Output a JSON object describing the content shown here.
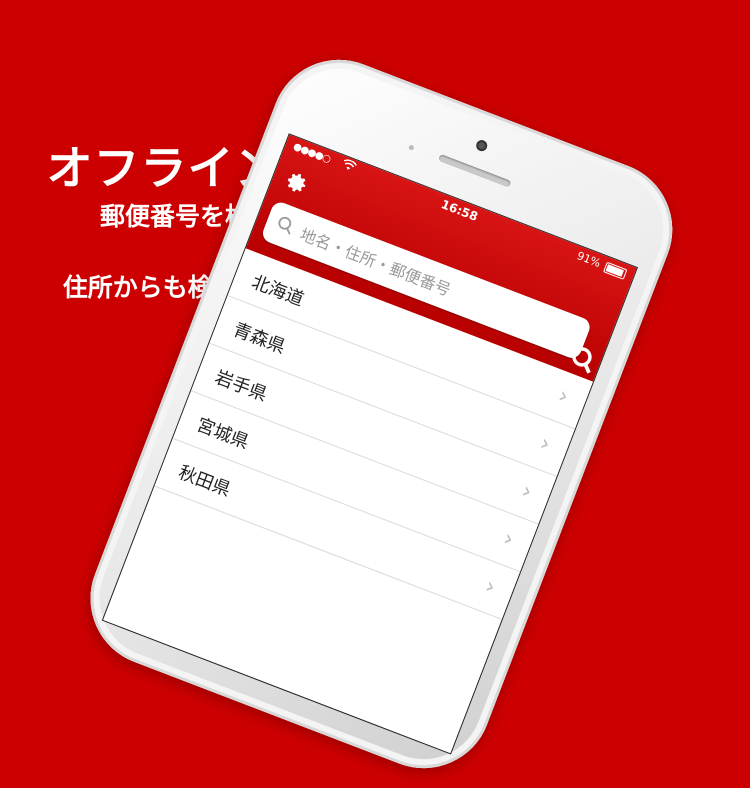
{
  "promo": {
    "line1": "オフラインで",
    "line2": "郵便番号を検索",
    "line3": "住所からも検索できる"
  },
  "status_bar": {
    "signal": "●●●●○",
    "wifi": "wifi-icon",
    "time": "16:58",
    "battery_text": "91%"
  },
  "nav": {
    "settings_icon": "gear-icon",
    "search_icon": "search-icon"
  },
  "search": {
    "placeholder": "地名・住所・郵便番号"
  },
  "prefectures": [
    {
      "label": "北海道"
    },
    {
      "label": "青森県"
    },
    {
      "label": "岩手県"
    },
    {
      "label": "宮城県"
    },
    {
      "label": "秋田県"
    }
  ],
  "colors": {
    "brand_red": "#cc0000"
  }
}
